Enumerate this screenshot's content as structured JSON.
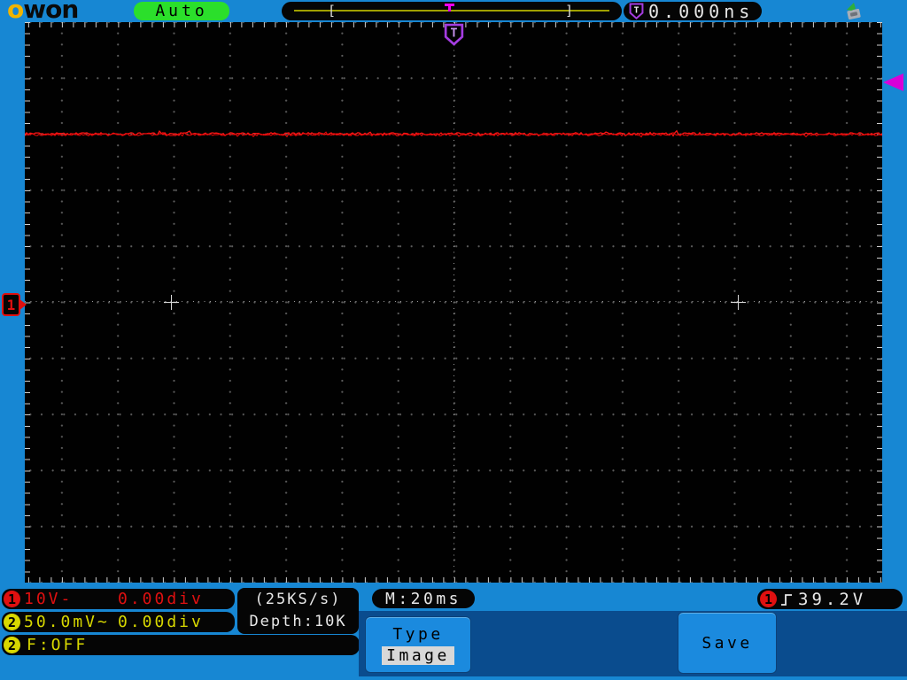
{
  "header": {
    "logo_first": "o",
    "logo_rest": "won",
    "mode": "Auto",
    "window_left_bracket": "[",
    "window_right_bracket": "]",
    "trigger_icon_letter": "T",
    "trigger_time": "0.000ns"
  },
  "grid": {
    "divisions_x": 15,
    "divisions_y": 10,
    "style": "dotted graticule, black background"
  },
  "chart_data": {
    "type": "line",
    "title": "CH1 flat DC trace with noise",
    "series": [
      {
        "name": "CH1",
        "color": "#ff1515",
        "shape": "flat noisy line",
        "level_divisions_above_center": 3.0,
        "volts_per_div": 10,
        "approx_level_V": 30
      }
    ],
    "x_axis": {
      "timebase": "20ms/div",
      "visible_divisions": 15.3
    },
    "y_axis": {
      "visible_divisions": 10
    },
    "annotations": [
      "trigger position marker T at top center",
      "trigger level arrow on right edge at 39.2V",
      "+ reference crosses at ±5 divisions on center horizontal line"
    ]
  },
  "channel_status": [
    {
      "id": "1",
      "scale": "10V-",
      "offset": "0.00div",
      "color": "#e01010"
    },
    {
      "id": "2",
      "scale": "50.0mV~",
      "offset": "0.00div",
      "color": "#d8d800"
    }
  ],
  "freq_status": {
    "id": "2",
    "text": "F:OFF"
  },
  "acquisition": {
    "sample_rate": "(25KS/s)",
    "depth": "Depth:10K"
  },
  "timebase": {
    "main": "M:20ms"
  },
  "trigger_status": {
    "channel": "1",
    "level": "39.2V",
    "edge": "rising"
  },
  "menu": {
    "type_label": "Type",
    "type_value": "Image",
    "save_label": "Save"
  },
  "colors": {
    "background": "#1787d3",
    "panel": "#0a4c8e",
    "mode_green": "#2bdf2b",
    "ch1_red": "#e01010",
    "ch2_yellow": "#d8d800",
    "trigger_purple": "#a43ce0",
    "trigger_magenta": "#d800d8",
    "trace_red": "#ff1515"
  }
}
